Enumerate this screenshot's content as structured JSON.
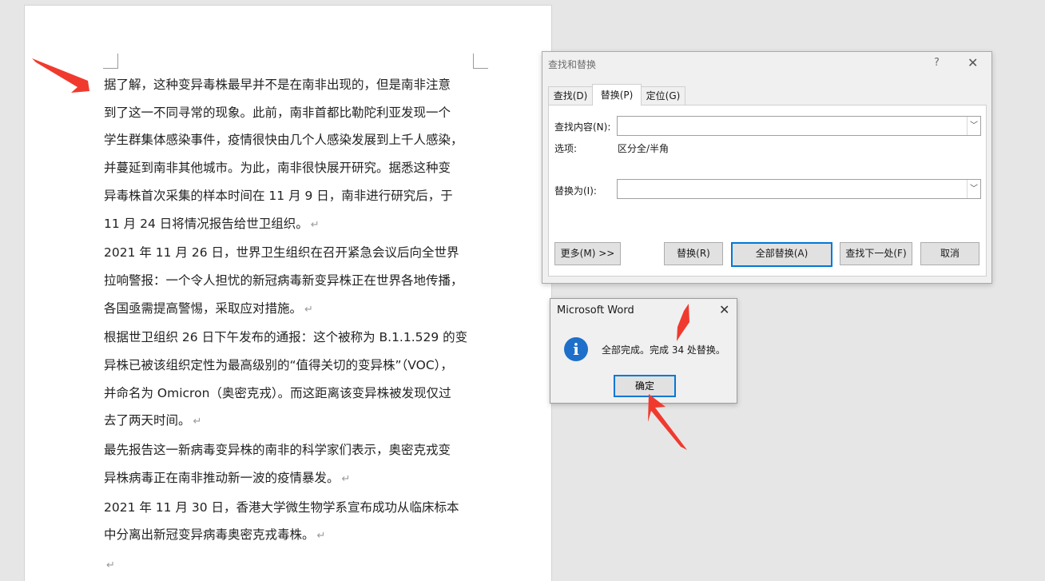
{
  "document": {
    "paragraphs": [
      [
        "据了解，这种变异毒株最早并不是在南非出现的，但是南非注意",
        "到了这一不同寻常的现象。此前，南非首都比勒陀利亚发现一个",
        "学生群集体感染事件，疫情很快由几个人感染发展到上千人感染，",
        "并蔓延到南非其他城市。为此，南非很快展开研究。据悉这种变",
        "异毒株首次采集的样本时间在 11 月 9 日，南非进行研究后，于",
        "11 月 24 日将情况报告给世卫组织。"
      ],
      [
        "2021 年 11 月 26 日，世界卫生组织在召开紧急会议后向全世界",
        "拉响警报：一个令人担忧的新冠病毒新变异株正在世界各地传播，",
        "各国亟需提高警惕，采取应对措施。"
      ],
      [
        "根据世卫组织 26 日下午发布的通报：这个被称为 B.1.1.529 的变",
        "异株已被该组织定性为最高级别的“值得关切的变异株”（VOC），",
        "并命名为 Omicron（奥密克戎）。而这距离该变异株被发现仅过",
        "去了两天时间。"
      ],
      [
        "最先报告这一新病毒变异株的南非的科学家们表示，奥密克戎变",
        "异株病毒正在南非推动新一波的疫情暴发。"
      ],
      [
        "2021 年 11 月 30 日，香港大学微生物学系宣布成功从临床标本",
        "中分离出新冠变异病毒奥密克戎毒株。"
      ]
    ],
    "paragraph_mark": "↵"
  },
  "find_replace": {
    "title": "查找和替换",
    "help": "?",
    "close": "✕",
    "tabs": [
      "查找(D)",
      "替换(P)",
      "定位(G)"
    ],
    "find_label": "查找内容(N):",
    "find_value": "",
    "options_label": "选项:",
    "options_value": "区分全/半角",
    "replace_label": "替换为(I):",
    "replace_value": "",
    "dropdown_glyph": "﹀",
    "buttons": {
      "more": "更多(M) >>",
      "replace": "替换(R)",
      "replace_all": "全部替换(A)",
      "find_next": "查找下一处(F)",
      "cancel": "取消"
    }
  },
  "message_box": {
    "title": "Microsoft Word",
    "close": "✕",
    "icon": "i",
    "message": "全部完成。完成 34 处替换。",
    "ok": "确定"
  },
  "colors": {
    "accent": "#0078d7",
    "arrow": "#f03a2e",
    "info": "#1e6fc9"
  }
}
